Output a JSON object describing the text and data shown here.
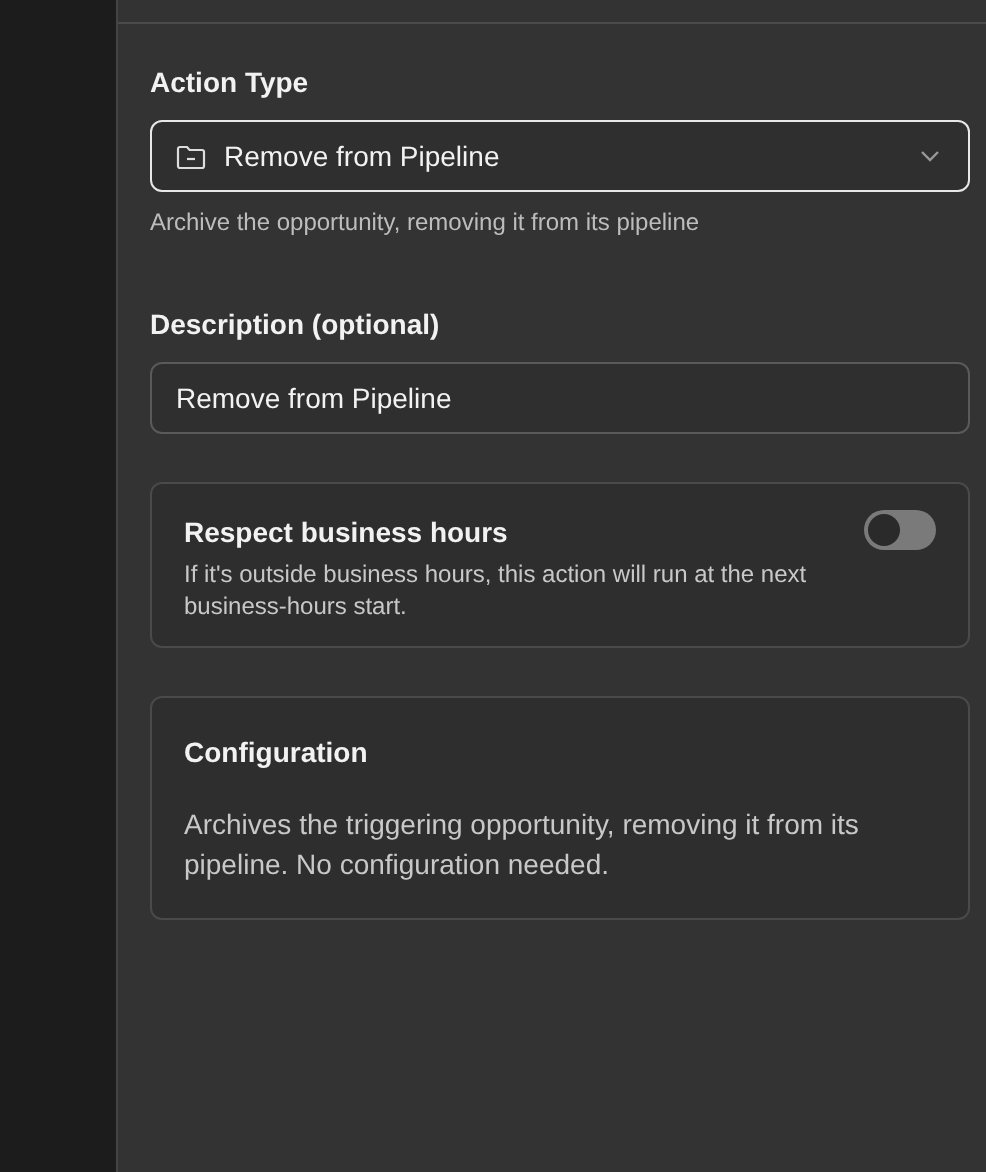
{
  "action_type": {
    "label": "Action Type",
    "value": "Remove from Pipeline",
    "hint": "Archive the opportunity, removing it from its pipeline"
  },
  "description": {
    "label": "Description (optional)",
    "value": "Remove from Pipeline"
  },
  "business_hours": {
    "title": "Respect business hours",
    "text": "If it's outside business hours, this action will run at the next business-hours start.",
    "on": false
  },
  "configuration": {
    "title": "Configuration",
    "text": "Archives the triggering opportunity, removing it from its pipeline. No configuration needed."
  }
}
